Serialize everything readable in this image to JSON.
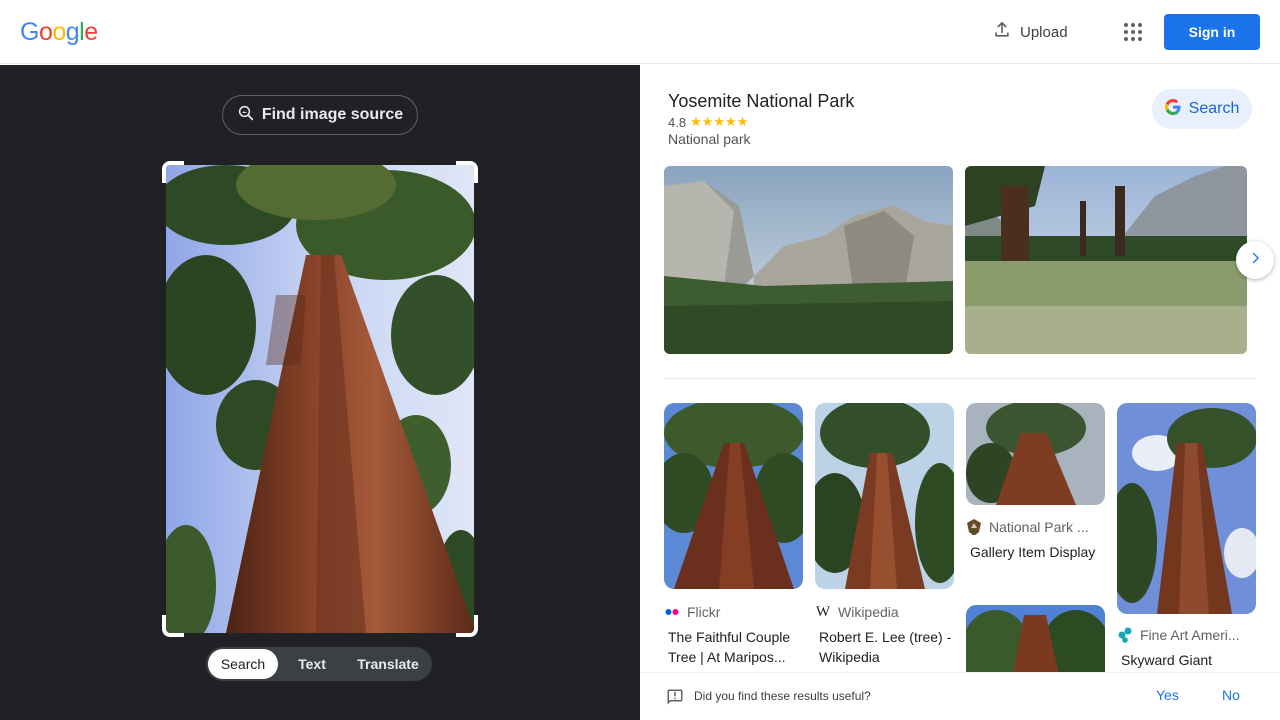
{
  "header": {
    "logo_letters": [
      "G",
      "o",
      "o",
      "g",
      "l",
      "e"
    ],
    "upload_label": "Upload",
    "signin_label": "Sign in"
  },
  "left_panel": {
    "find_source_label": "Find image source",
    "mode_tabs": [
      {
        "label": "Search",
        "active": true
      },
      {
        "label": "Text",
        "active": false
      },
      {
        "label": "Translate",
        "active": false
      }
    ]
  },
  "knowledge_panel": {
    "title": "Yosemite National Park",
    "rating": "4.8",
    "stars": "★★★★★",
    "type": "National park",
    "search_label": "Search"
  },
  "results": [
    {
      "source": "Flickr",
      "title": "The Faithful Couple Tree | At Maripos..."
    },
    {
      "source": "Wikipedia",
      "title": "Robert E. Lee (tree) - Wikipedia"
    },
    {
      "source": "National Park ...",
      "title": "Gallery Item Display"
    },
    {
      "source": "Fine Art Ameri...",
      "title": "Skyward Giant"
    }
  ],
  "feedback": {
    "question": "Did you find these results useful?",
    "yes_label": "Yes",
    "no_label": "No"
  },
  "colors": {
    "brand_blue": "#1a73e8",
    "dark_panel": "#202124",
    "logo_blue": "#4285f4",
    "logo_red": "#ea4335",
    "logo_yellow": "#fbbc05",
    "logo_green": "#34a853",
    "star_yellow": "#fbbc04"
  }
}
